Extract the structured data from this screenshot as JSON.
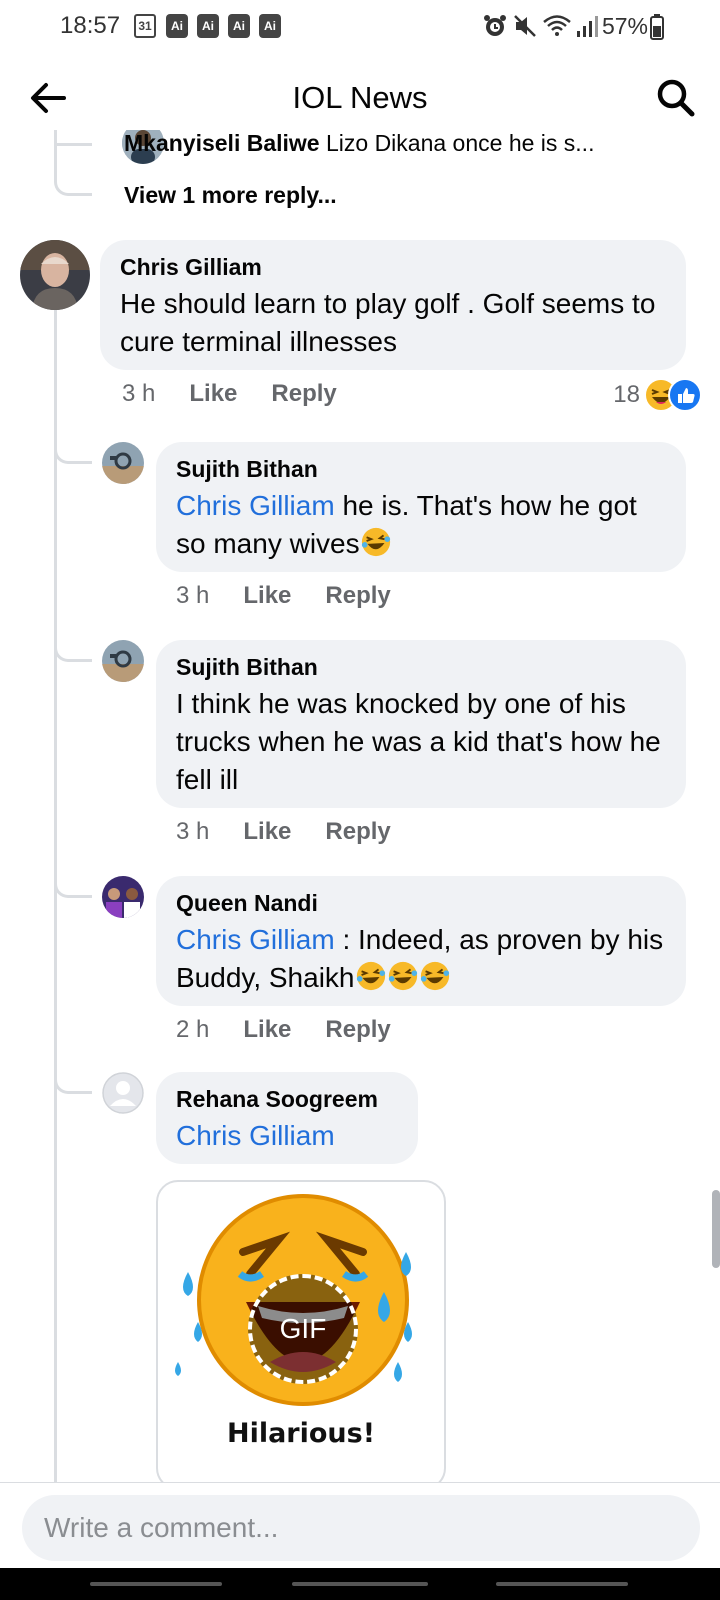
{
  "status_bar": {
    "time": "18:57",
    "calendar_day": "31",
    "ai_badges": [
      "Ai",
      "Ai",
      "Ai",
      "Ai"
    ],
    "battery": "57%",
    "icons": [
      "alarm-icon",
      "mute-icon",
      "wifi-icon",
      "signal-icon",
      "battery-icon"
    ]
  },
  "app_bar": {
    "title": "IOL News",
    "back_icon": "arrow-left-icon",
    "search_icon": "search-icon"
  },
  "previous_reply": {
    "name": "Mkanyiseli Baliwe",
    "text": "Lizo Dikana once he is s..."
  },
  "view_more": "View 1 more reply...",
  "comments": [
    {
      "name": "Chris Gilliam",
      "mention": "",
      "text": "He should learn to play golf . Golf seems to cure terminal illnesses",
      "time": "3 h",
      "like": "Like",
      "reply": "Reply",
      "reaction_count": "18"
    },
    {
      "name": "Sujith Bithan",
      "mention": "Chris Gilliam",
      "text": " he is. That's how he got so many wives",
      "time": "3 h",
      "like": "Like",
      "reply": "Reply"
    },
    {
      "name": "Sujith Bithan",
      "mention": "",
      "text": "I think he was knocked by one of his trucks when he was a kid that's how he fell ill",
      "time": "3 h",
      "like": "Like",
      "reply": "Reply"
    },
    {
      "name": "Queen Nandi",
      "mention": "Chris Gilliam",
      "text": " : Indeed, as proven by his Buddy, Shaikh",
      "time": "2 h",
      "like": "Like",
      "reply": "Reply"
    },
    {
      "name": "Rehana Soogreem",
      "mention": "Chris Gilliam",
      "text": "",
      "gif_caption": "Hilarious!",
      "gif_badge": "GIF"
    }
  ],
  "composer": {
    "placeholder": "Write a comment..."
  },
  "colors": {
    "bubble": "#f0f2f5",
    "mention": "#216fdb",
    "meta": "#65676b",
    "like_blue": "#1877f2",
    "laugh_yellow": "#f7b928"
  }
}
